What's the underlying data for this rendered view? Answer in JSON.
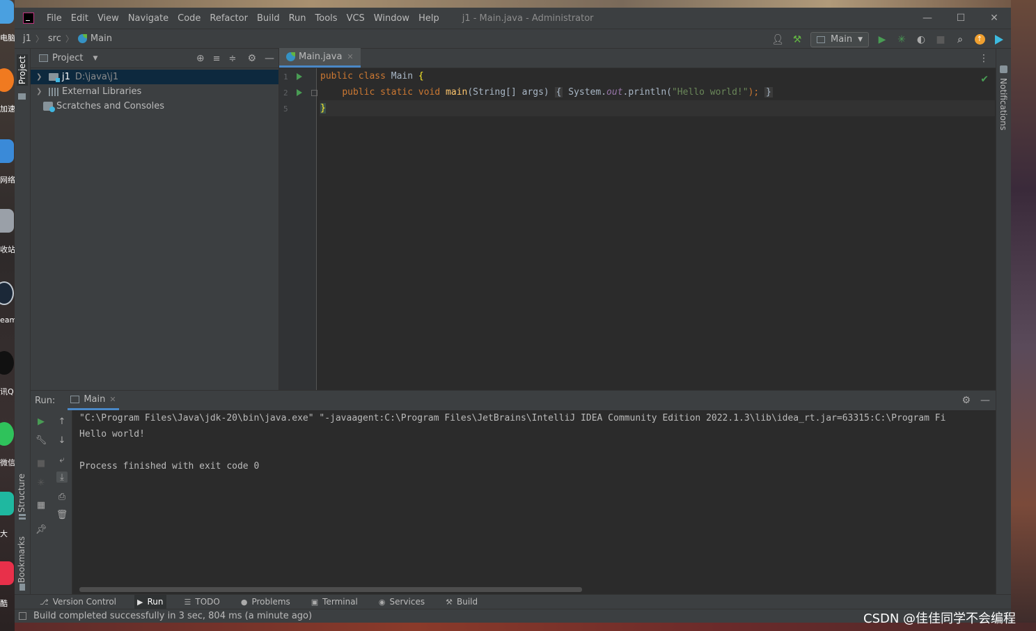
{
  "desktop": {
    "labels": [
      "电脑",
      "加速",
      "网络",
      "收站",
      "eam",
      "讯Q",
      "微信",
      "大",
      "酷"
    ],
    "watermark": "CSDN @佳佳同学不会编程"
  },
  "window": {
    "title": "j1 - Main.java - Administrator",
    "menu": [
      "File",
      "Edit",
      "View",
      "Navigate",
      "Code",
      "Refactor",
      "Build",
      "Run",
      "Tools",
      "VCS",
      "Window",
      "Help"
    ],
    "minimize": "—",
    "maximize": "☐",
    "close": "✕"
  },
  "navbar": {
    "breadcrumbs": [
      "j1",
      "src",
      "Main"
    ],
    "run_config": "Main"
  },
  "side_tabs": {
    "project": "Project",
    "structure": "Structure",
    "bookmarks": "Bookmarks",
    "notifications": "Notifications"
  },
  "project": {
    "header": "Project",
    "tree": [
      {
        "label": "j1",
        "path": "D:\\java\\j1"
      },
      {
        "label": "External Libraries"
      },
      {
        "label": "Scratches and Consoles"
      }
    ]
  },
  "editor": {
    "tab": "Main.java",
    "line_numbers": [
      "1",
      "2",
      "5"
    ],
    "lines": [
      {
        "kw1": "public ",
        "kw2": "class ",
        "name": "Main ",
        "brace": "{"
      },
      {
        "indent": "    ",
        "kw1": "public ",
        "kw2": "static ",
        "kw3": "void ",
        "method": "main",
        "params": "(String[] args) ",
        "fold_open": "{",
        "sys": " System.",
        "field": "out",
        "call": ".println(",
        "str": "\"Hello world!\"",
        "end": ");",
        "fold_close": "}"
      },
      {
        "brace": "}"
      }
    ]
  },
  "run": {
    "label": "Run:",
    "tab": "Main",
    "console": [
      "\"C:\\Program Files\\Java\\jdk-20\\bin\\java.exe\" \"-javaagent:C:\\Program Files\\JetBrains\\IntelliJ IDEA Community Edition 2022.1.3\\lib\\idea_rt.jar=63315:C:\\Program Fi",
      "Hello world!",
      "",
      "Process finished with exit code 0"
    ]
  },
  "bottom_tools": [
    "Version Control",
    "Run",
    "TODO",
    "Problems",
    "Terminal",
    "Services",
    "Build"
  ],
  "status": "Build completed successfully in 3 sec, 804 ms (a minute ago)",
  "colors": {
    "accent": "#4a88c7",
    "run_green": "#499c54",
    "keyword": "#cc7832",
    "string": "#6a8759",
    "method": "#ffc66d"
  }
}
